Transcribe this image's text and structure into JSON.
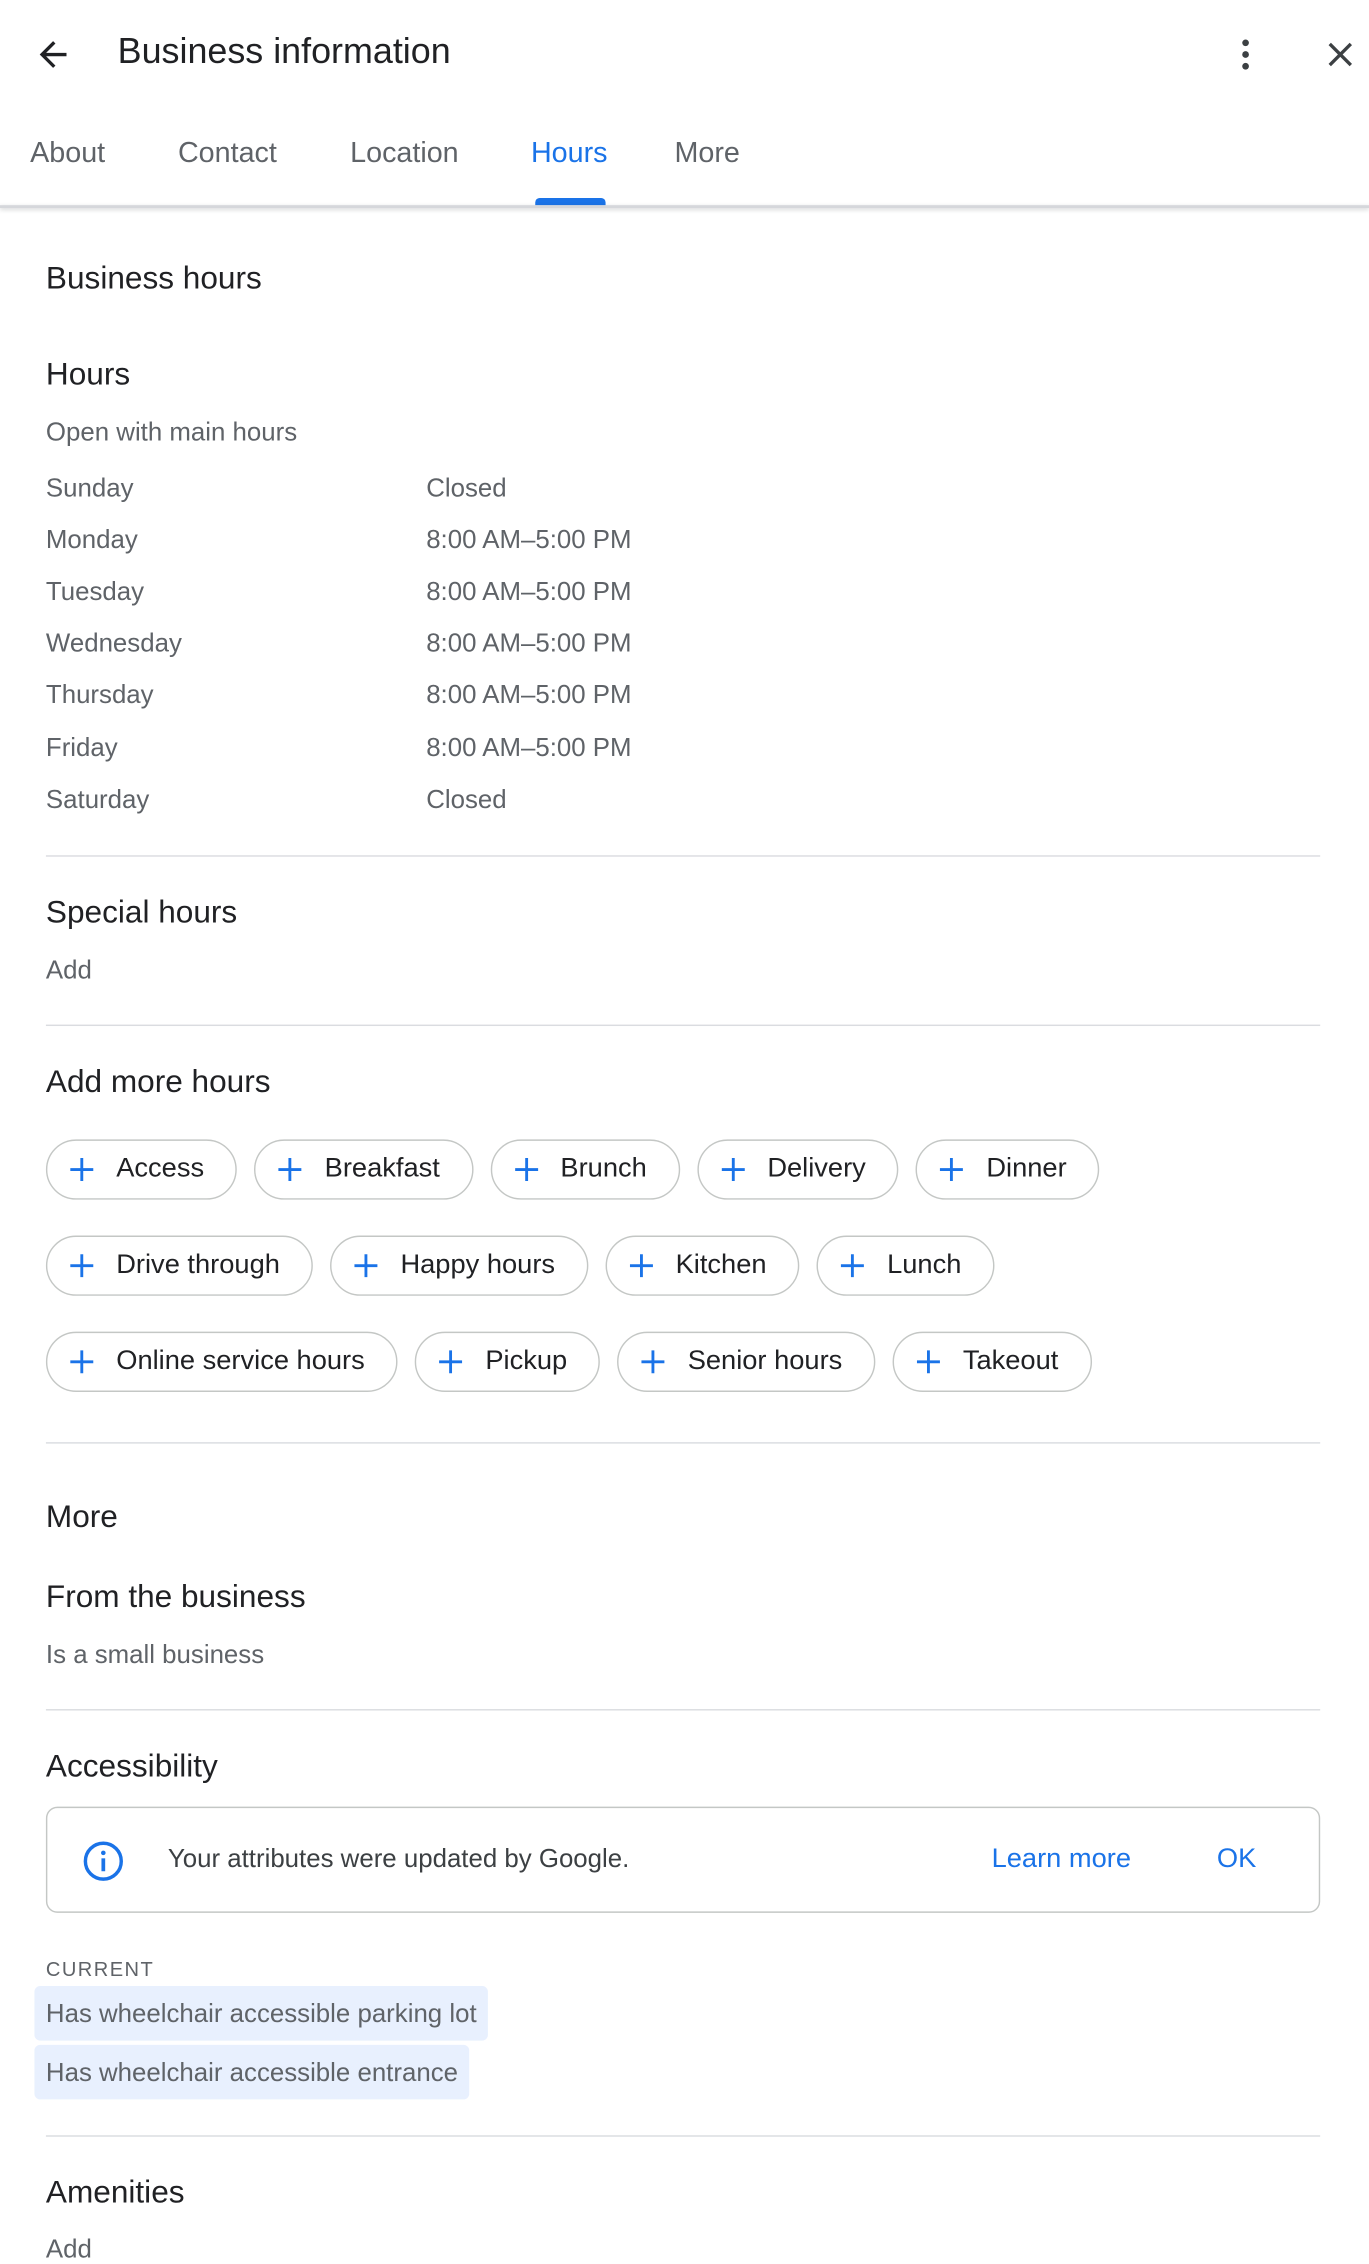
{
  "header": {
    "title": "Business information"
  },
  "tabs": [
    {
      "label": "About"
    },
    {
      "label": "Contact"
    },
    {
      "label": "Location"
    },
    {
      "label": "Hours"
    },
    {
      "label": "More"
    }
  ],
  "hours_section": {
    "title": "Business hours",
    "hours_label": "Hours",
    "status": "Open with main hours",
    "days": [
      {
        "day": "Sunday",
        "time": "Closed"
      },
      {
        "day": "Monday",
        "time": "8:00 AM–5:00 PM"
      },
      {
        "day": "Tuesday",
        "time": "8:00 AM–5:00 PM"
      },
      {
        "day": "Wednesday",
        "time": "8:00 AM–5:00 PM"
      },
      {
        "day": "Thursday",
        "time": "8:00 AM–5:00 PM"
      },
      {
        "day": "Friday",
        "time": "8:00 AM–5:00 PM"
      },
      {
        "day": "Saturday",
        "time": "Closed"
      }
    ],
    "special_hours_label": "Special hours",
    "special_hours_value": "Add",
    "add_more_label": "Add more hours",
    "chips": [
      "Access",
      "Breakfast",
      "Brunch",
      "Delivery",
      "Dinner",
      "Drive through",
      "Happy hours",
      "Kitchen",
      "Lunch",
      "Online service hours",
      "Pickup",
      "Senior hours",
      "Takeout"
    ]
  },
  "more_section": {
    "title": "More",
    "from_business_label": "From the business",
    "from_business_value": "Is a small business",
    "accessibility_label": "Accessibility",
    "notice_text": "Your attributes were updated by Google.",
    "learn_more": "Learn more",
    "ok": "OK",
    "current_label": "CURRENT",
    "current_items": [
      "Has wheelchair accessible parking lot",
      "Has wheelchair accessible entrance"
    ],
    "amenities_label": "Amenities",
    "amenities_value": "Add"
  },
  "colors": {
    "accent": "#1a73e8",
    "text": "#202124",
    "muted": "#5f6368",
    "divider": "#dadce0",
    "pill_bg": "#e8f0fe"
  }
}
